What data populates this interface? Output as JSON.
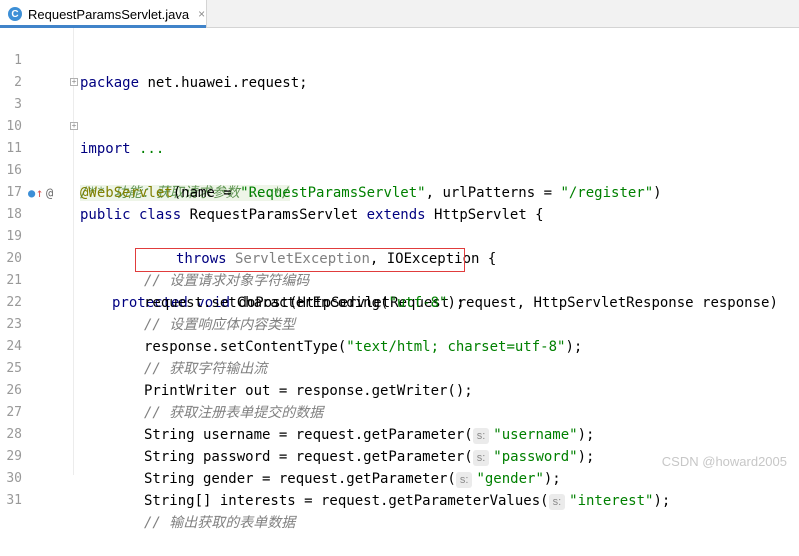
{
  "tab": {
    "title": "RequestParamsServlet.java",
    "icon": "C",
    "close": "×"
  },
  "gutter_icons": {
    "override": "↑",
    "annotation": "@"
  },
  "hints": {
    "s": "s:"
  },
  "code": {
    "l1": {
      "num": "1",
      "kw": "package",
      "rest": " net.huawei.request;"
    },
    "l3": {
      "num": "3",
      "kw": "import",
      "rest": " ..."
    },
    "l11": {
      "num": "11",
      "doc": "/** 功能：获取请求参数 ...*/"
    },
    "l16": {
      "num": "16",
      "ann": "@WebServlet",
      "p1": "(name = ",
      "s1": "\"RequestParamsServlet\"",
      "p2": ", urlPatterns = ",
      "s2": "\"/register\"",
      "p3": ")"
    },
    "l17": {
      "num": "17",
      "kw1": "public class",
      "p1": " RequestParamsServlet ",
      "kw2": "extends",
      "p2": " HttpServlet {"
    },
    "l18": {
      "num": "18",
      "kw1": "protected void",
      "p1": " doPost(HttpServletRequest request, HttpServletResponse response)"
    },
    "l19": {
      "num": "19",
      "kw1": "throws",
      "g1": " ServletException",
      "p1": ", IOException {"
    },
    "l20": {
      "num": "20",
      "comment": "// 设置请求对象字符编码"
    },
    "l21": {
      "num": "21",
      "p1": "request.setCharacterEncoding(",
      "s1": "\"utf-8\"",
      "p2": ");"
    },
    "l22": {
      "num": "22",
      "comment": "// 设置响应体内容类型"
    },
    "l23": {
      "num": "23",
      "p1": "response.setContentType(",
      "s1": "\"text/html; charset=utf-8\"",
      "p2": ");"
    },
    "l24": {
      "num": "24",
      "comment": "// 获取字符输出流"
    },
    "l25": {
      "num": "25",
      "p1": "PrintWriter out = response.getWriter();"
    },
    "l26": {
      "num": "26",
      "comment": "// 获取注册表单提交的数据"
    },
    "l27": {
      "num": "27",
      "p1": "String username = request.getParameter(",
      "s1": "\"username\"",
      "p2": ");"
    },
    "l28": {
      "num": "28",
      "p1": "String password = request.getParameter(",
      "s1": "\"password\"",
      "p2": ");"
    },
    "l29": {
      "num": "29",
      "p1": "String gender = request.getParameter(",
      "s1": "\"gender\"",
      "p2": ");"
    },
    "l30": {
      "num": "30",
      "p1": "String[] interests = request.getParameterValues(",
      "s1": "\"interest\"",
      "p2": ");"
    },
    "l31": {
      "num": "31",
      "comment": "// 输出获取的表单数据"
    }
  },
  "watermark": "CSDN @howard2005"
}
